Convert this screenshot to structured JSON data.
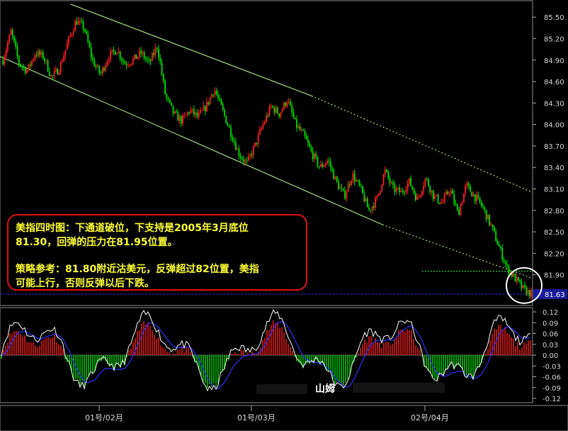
{
  "annotation": {
    "line1": "美指四时图：下通道破位，下支持是2005年3月底位",
    "line2": "81.30，回弹的压力在81.95位置。",
    "line3": "策略参考：81.80附近沽美元，反弹超过82位置，美指",
    "line4": "可能上行，否则反弹以后下跌。"
  },
  "author": "山姆",
  "colors": {
    "up": "#ff2020",
    "down": "#00e000",
    "channel": "#b8ff90",
    "current": "#2a2aff",
    "resistance": "#3aff3a",
    "macd_line": "#ffffff",
    "signal_line": "#3030ff"
  },
  "chart_data": [
    {
      "type": "candlestick",
      "title": "",
      "ylim": [
        81.5,
        85.7
      ],
      "y_ticks": [
        "85.50",
        "85.20",
        "84.90",
        "84.60",
        "84.30",
        "84.00",
        "83.70",
        "83.40",
        "83.10",
        "82.80",
        "82.50",
        "82.20",
        "81.90",
        "81.60"
      ],
      "x_labels": [
        "01号/02月",
        "01号/03月",
        "02号/04月"
      ],
      "current_value": "81.63",
      "resistance_level": 81.95,
      "support_level": 81.3,
      "close_path": [
        84.9,
        85.3,
        84.85,
        84.75,
        85.0,
        84.95,
        84.65,
        84.8,
        85.15,
        85.45,
        85.35,
        84.9,
        84.7,
        84.95,
        85.05,
        84.85,
        84.9,
        85.0,
        84.85,
        85.1,
        84.4,
        84.15,
        84.05,
        84.2,
        84.1,
        84.25,
        84.5,
        84.2,
        83.9,
        83.6,
        83.45,
        83.7,
        84.0,
        84.25,
        84.15,
        84.35,
        84.0,
        83.85,
        83.6,
        83.4,
        83.5,
        83.2,
        83.0,
        83.3,
        83.1,
        82.8,
        82.95,
        83.35,
        83.1,
        83.05,
        83.2,
        82.95,
        83.25,
        83.0,
        82.9,
        83.1,
        82.75,
        83.15,
        83.0,
        82.85,
        82.6,
        82.3,
        82.0,
        81.85,
        81.7,
        81.63
      ]
    },
    {
      "type": "bar",
      "title": "",
      "ylim": [
        -0.12,
        0.12
      ],
      "y_ticks": [
        "0.12",
        "0.09",
        "0.06",
        "0.03",
        "0.00",
        "-0.03",
        "-0.06",
        "-0.09",
        "-0.12"
      ]
    }
  ]
}
